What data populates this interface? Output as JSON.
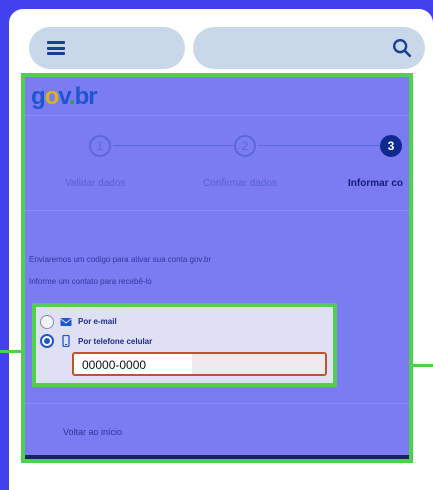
{
  "browser": {
    "menu_icon": "hamburger-icon",
    "search_placeholder": "",
    "search_icon": "search-icon"
  },
  "logo": {
    "g": "g",
    "o": "o",
    "v": "v",
    "dot": ".",
    "br": "br"
  },
  "stepper": {
    "steps": [
      {
        "number": "1",
        "label": "Validar dados",
        "active": false
      },
      {
        "number": "2",
        "label": "Confirmar dados",
        "active": false
      },
      {
        "number": "3",
        "label": "Informar co",
        "active": true
      }
    ]
  },
  "info": {
    "line1": "Enviaremos um codigo para ativar sua conta gov.br",
    "line2": "Informe um contato para recebê-lo"
  },
  "contact": {
    "options": [
      {
        "label": "Por e-mail",
        "icon": "envelope-icon",
        "checked": false
      },
      {
        "label": "Por telefone celular",
        "icon": "phone-icon",
        "checked": true
      }
    ],
    "phone_value": "00000-0000"
  },
  "footer": {
    "back_label": "Voltar ao início"
  },
  "colors": {
    "background": "#4141ee",
    "highlight": "#4fd04f",
    "overlay": "#7b7bf2",
    "input_border": "#c0532f"
  }
}
